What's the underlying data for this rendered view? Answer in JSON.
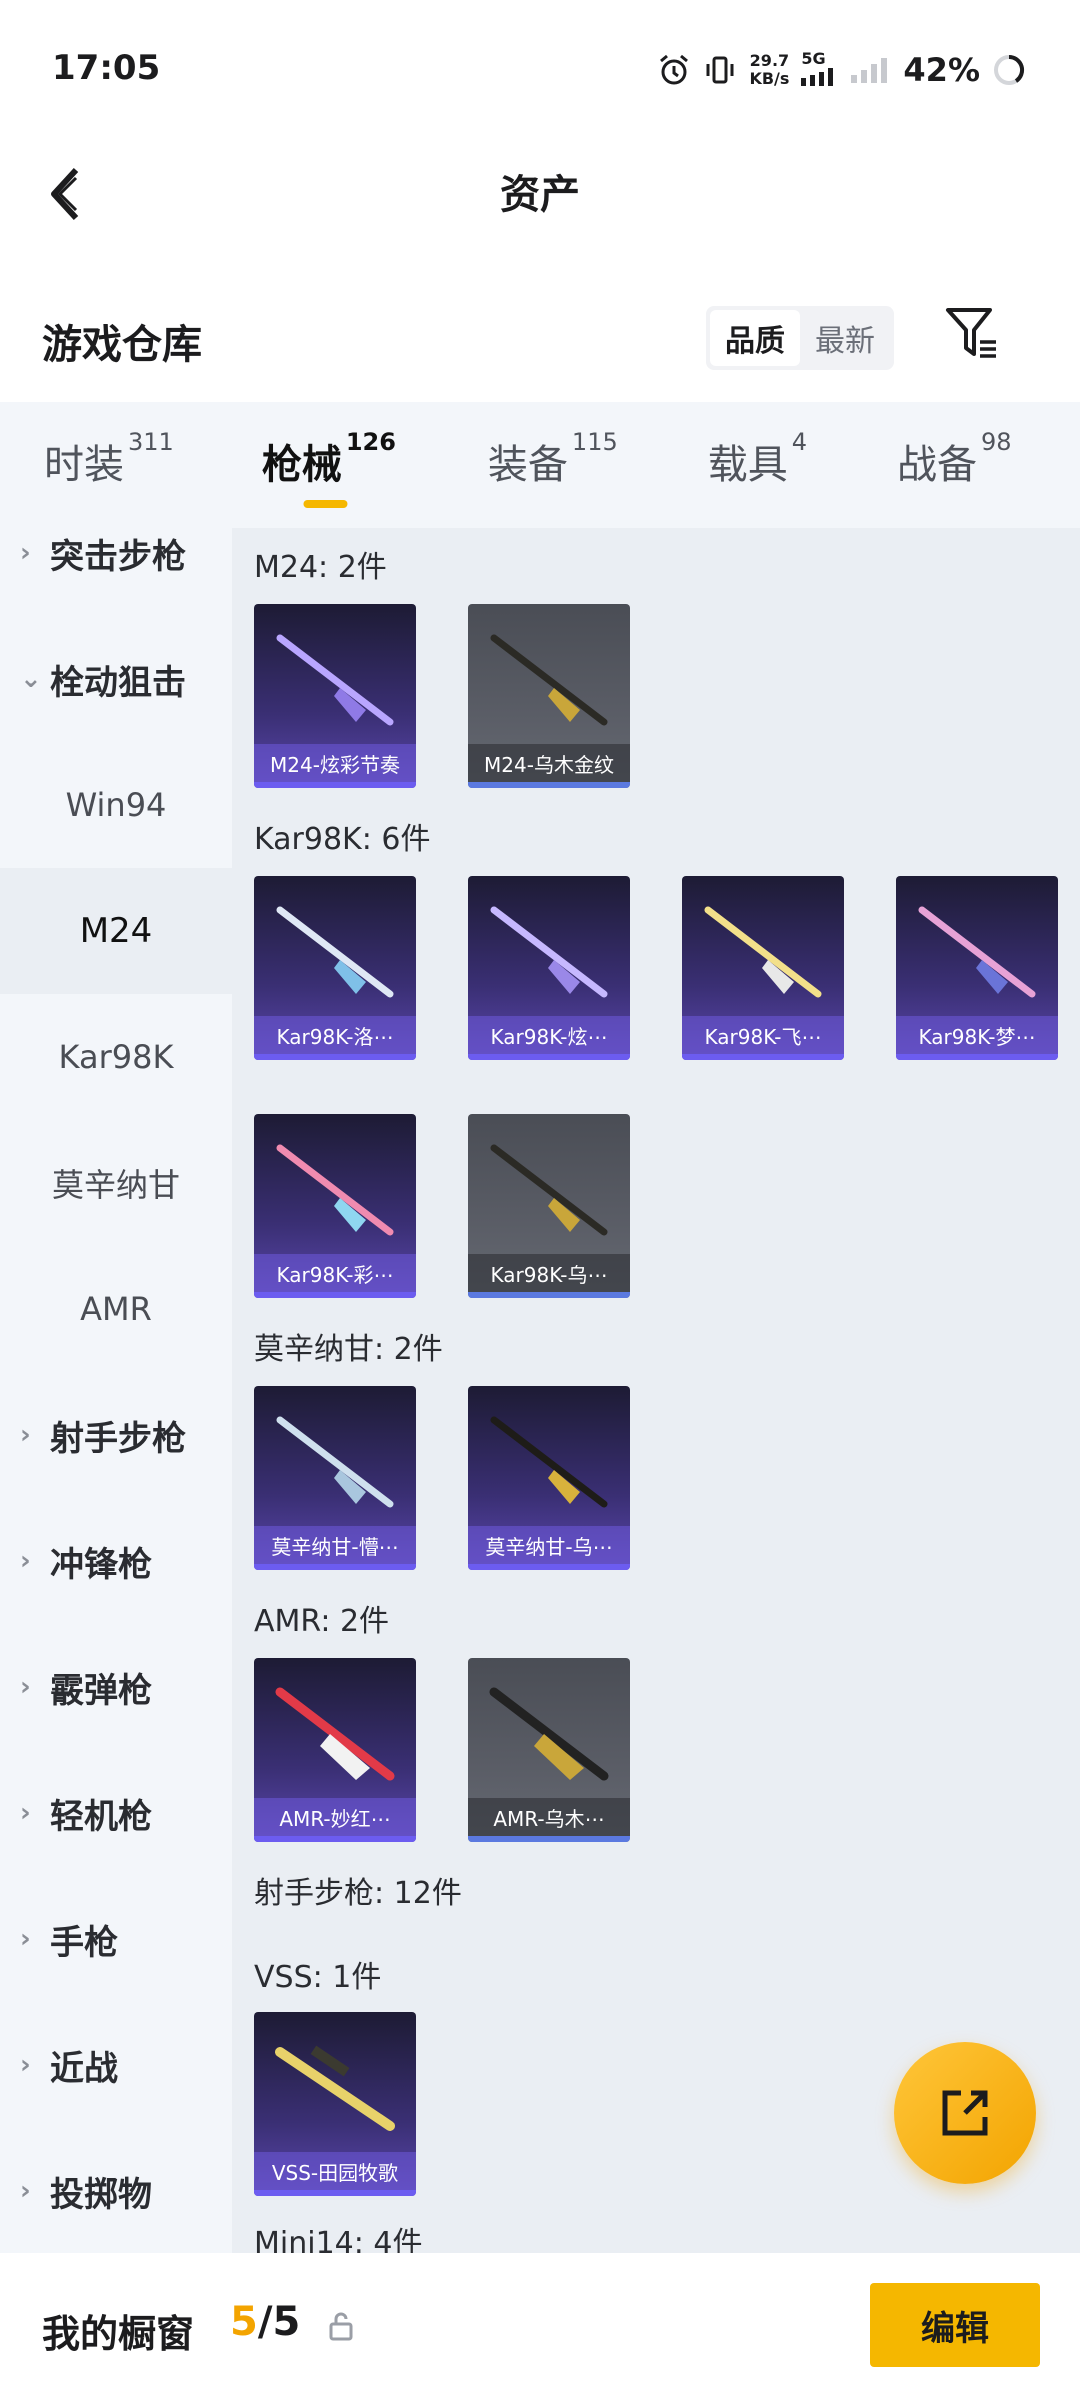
{
  "status": {
    "time": "17:05",
    "net_speed": "29.7",
    "net_unit": "KB/s",
    "network": "5G",
    "battery": "42%"
  },
  "header": {
    "title": "资产"
  },
  "section": {
    "title": "游戏仓库",
    "sort_quality": "品质",
    "sort_newest": "最新"
  },
  "tabs": [
    {
      "label": "时装",
      "count": "311"
    },
    {
      "label": "枪械",
      "count": "126"
    },
    {
      "label": "装备",
      "count": "115"
    },
    {
      "label": "载具",
      "count": "4"
    },
    {
      "label": "战备",
      "count": "98"
    }
  ],
  "subnav": {
    "assault": "突击步枪",
    "bolt": "栓动狙击",
    "win94": "Win94",
    "m24": "M24",
    "kar98k": "Kar98K",
    "mosin": "莫辛纳甘",
    "amr": "AMR",
    "dmr": "射手步枪",
    "smg": "冲锋枪",
    "shotgun": "霰弹枪",
    "lmg": "轻机枪",
    "pistol": "手枪",
    "melee": "近战",
    "throwable": "投掷物"
  },
  "groups": {
    "m24": "M24: 2件",
    "kar98k": "Kar98K: 6件",
    "mosin": "莫辛纳甘: 2件",
    "amr": "AMR: 2件",
    "dmr": "射手步枪: 12件",
    "vss": "VSS: 1件",
    "mini14": "Mini14: 4件"
  },
  "items": {
    "m24_1": "M24-炫彩节奏",
    "m24_2": "M24-乌木金纹",
    "kar_1": "Kar98K-洛⋯",
    "kar_2": "Kar98K-炫⋯",
    "kar_3": "Kar98K-飞⋯",
    "kar_4": "Kar98K-梦⋯",
    "kar_5": "Kar98K-彩⋯",
    "kar_6": "Kar98K-乌⋯",
    "mosin_1": "莫辛纳甘-懵⋯",
    "mosin_2": "莫辛纳甘-乌⋯",
    "amr_1": "AMR-妙红⋯",
    "amr_2": "AMR-乌木⋯",
    "vss_1": "VSS-田园牧歌"
  },
  "bottom": {
    "label": "我的橱窗",
    "current": "5",
    "sep": "/",
    "total": "5",
    "edit": "编辑"
  },
  "colors": {
    "accent": "#f5b700",
    "purple_card": "#3a2f74",
    "gray_card": "#5a5d66"
  }
}
